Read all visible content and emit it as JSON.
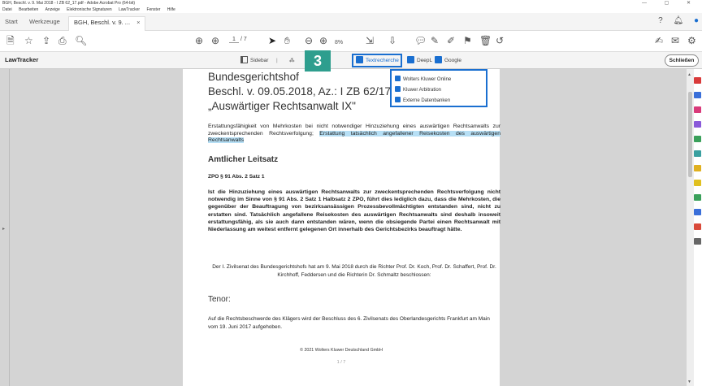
{
  "window": {
    "title": "BGH, Beschl. v. 9. Mai 2018 - I ZB 62_17.pdf - Adobe Acrobat Pro (64-bit)",
    "controls": "— ▢ ✕",
    "menu": [
      "Datei",
      "Bearbeiten",
      "Anzeige",
      "Elektronische Signaturen",
      "LawTracker",
      "Fenster",
      "Hilfe"
    ]
  },
  "tabs": {
    "start": "Start",
    "tools": "Werkzeuge",
    "doc": "BGH, Beschl. v. 9. ...",
    "close": "×"
  },
  "toolbar": {
    "page_current": "1",
    "page_total": "/ 7",
    "zoom": "8%"
  },
  "lawtracker": {
    "brand": "LawTracker",
    "sidebar": "Sidebar",
    "textrecherche": "Textrecherche",
    "deepl": "DeepL",
    "google": "Google",
    "close": "Schließen",
    "step": "3"
  },
  "dropdown": {
    "items": [
      "Wolters Kluwer Online",
      "Kluwer Arbitration",
      "Externe Datenbanken"
    ]
  },
  "document": {
    "court": "Bundesgerichtshof",
    "ref": "Beschl. v. 09.05.2018, Az.: I ZB 62/17",
    "case": "„Auswärtiger Rechtsanwalt IX\"",
    "summary_plain": "Erstattungsfähigkeit von Mehrkosten bei nicht notwendiger Hinzuziehung eines auswärtigen Rechtsanwalts zur zweckentsprechenden Rechtsverfolgung; ",
    "summary_highlight": "Erstattung tatsächlich angefallener Reisekosten des auswärtigen Rechtsanwalts",
    "leitsatz_heading": "Amtlicher Leitsatz",
    "zpo": "ZPO § 91 Abs. 2 Satz 1",
    "leitsatz_body": "Ist die Hinzuziehung eines auswärtigen Rechtsanwalts zur zweckentsprechenden Rechtsverfolgung nicht notwendig im Sinne von § 91 Abs. 2 Satz 1 Halbsatz 2 ZPO, führt dies lediglich dazu, dass die Mehrkosten, die gegenüber der Beauftragung von bezirksansässigen Prozessbevollmächtigten entstanden sind, nicht zu erstatten sind. Tatsächlich angefallene Reisekosten des auswärtigen Rechtsanwalts sind deshalb insoweit erstattungsfähig, als sie auch dann entstanden wären, wenn die obsiegende Partei einen Rechtsanwalt mit Niederlassung am weitest entfernt gelegenen Ort innerhalb des Gerichtsbezirks beauftragt hätte.",
    "senat": "Der I. Zivilsenat des Bundesgerichtshofs hat am 9. Mai 2018 durch die Richter Prof. Dr. Koch, Prof. Dr. Schaffert, Prof. Dr. Kirchhoff, Feddersen und die Richterin Dr. Schmaltz beschlossen:",
    "tenor_heading": "Tenor:",
    "tenor_body": "Auf die Rechtsbeschwerde des Klägers wird der Beschluss des 6. Zivilsenats des Oberlandesgerichts Frankfurt am Main vom 19. Juni 2017 aufgehoben.",
    "copyright": "© 2021 Wolters Kluwer Deutschland GmbH",
    "page_number": "1 / 7"
  }
}
